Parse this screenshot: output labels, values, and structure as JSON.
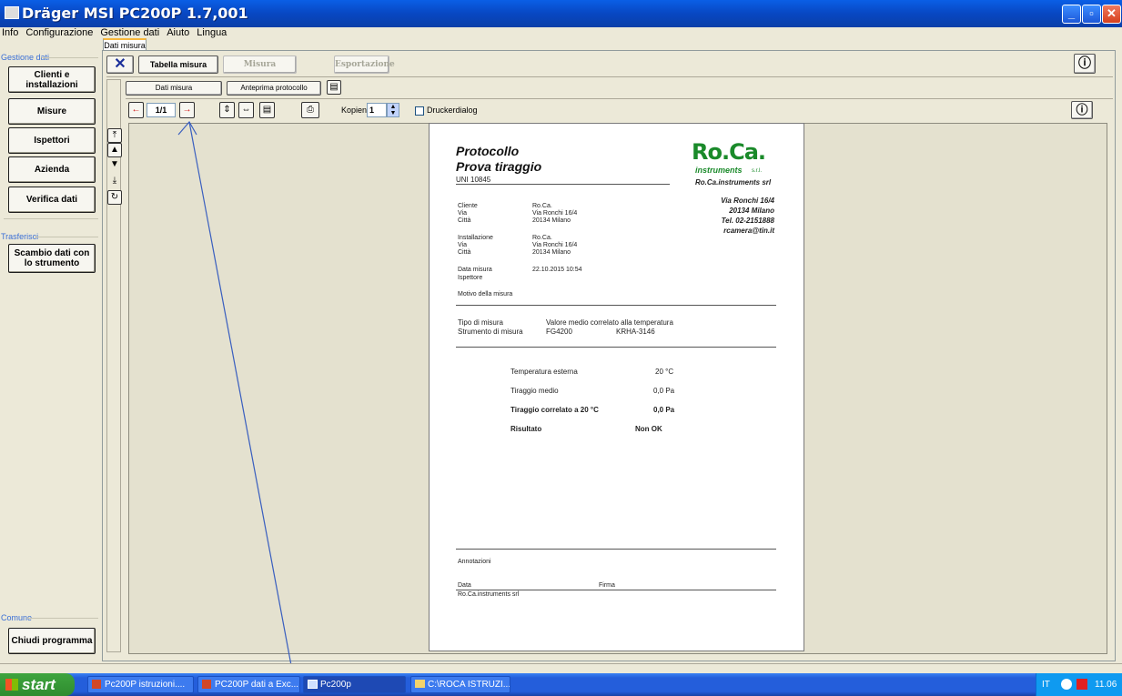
{
  "window": {
    "title": "Dräger MSI PC200P 1.7,001"
  },
  "menu": [
    "Info",
    "Configurazione",
    "Gestione dati",
    "Aiuto",
    "Lingua"
  ],
  "sidebar": {
    "group_gestione": "Gestione dati",
    "clienti": "Clienti e installazioni",
    "misure": "Misure",
    "ispettori": "Ispettori",
    "azienda": "Azienda",
    "verifica": "Verifica dati",
    "group_trasferisci": "Trasferisci",
    "scambio": "Scambio dati con lo strumento",
    "group_comune": "Comune",
    "chiudi": "Chiudi programma"
  },
  "tabs": {
    "dati_misura": "Dati misura"
  },
  "toolbar": {
    "tabella": "Tabella misura",
    "misura": "Misura",
    "esportazione": "Esportazione",
    "subtab_dati": "Dati misura",
    "subtab_anteprima": "Anteprima protocollo"
  },
  "viewer": {
    "page_indicator": "1/1",
    "kopien_label": "Kopien",
    "kopien_value": "1",
    "druckerdialog": "Druckerdialog"
  },
  "document": {
    "title1": "Protocollo",
    "title2": "Prova tiraggio",
    "norm": "UNI 10845",
    "logo_line1": "Ro.Ca.",
    "logo_line2": "instruments",
    "logo_srl": "s.r.l.",
    "company": "Ro.Ca.instruments srl",
    "addr1": "Via Ronchi 16/4",
    "addr2": "20134 Milano",
    "tel": "Tel. 02-2151888",
    "email": "rcamera@tin.it",
    "cliente_label": "Cliente",
    "cliente_value": "Ro.Ca.",
    "via_label": "Via",
    "via_value": "Via Ronchi 16/4",
    "citta_label": "Città",
    "citta_value": "20134 Milano",
    "install_label": "Installazione",
    "install_value": "Ro.Ca.",
    "via2_value": "Via Ronchi 16/4",
    "citta2_value": "20134 Milano",
    "data_label": "Data misura",
    "data_value": "22.10.2015 10:54",
    "ispettore_label": "Ispettore",
    "motivo_label": "Motivo della misura",
    "tipo_label": "Tipo di misura",
    "tipo_value": "Valore medio correlato alla temperatura",
    "strumento_label": "Strumento di misura",
    "strumento_value": "FG4200",
    "strumento_serial": "KRHA-3146",
    "temp_label": "Temperatura esterna",
    "temp_value": "20 °C",
    "tiraggio_label": "Tiraggio medio",
    "tiraggio_value": "0,0 Pa",
    "corr_label": "Tiraggio correlato a 20 °C",
    "corr_value": "0,0 Pa",
    "risultato_label": "Risultato",
    "risultato_value": "Non OK",
    "annotazioni": "Annotazioni",
    "footer_data": "Data",
    "footer_firma": "Firma",
    "footer_company": "Ro.Ca.instruments srl"
  },
  "taskbar": {
    "start": "start",
    "items": [
      "Pc200P istruzioni....",
      "PC200P dati a Exc...",
      "Pc200p",
      "C:\\ROCA ISTRUZI..."
    ],
    "lang": "IT",
    "clock": "11.06"
  }
}
